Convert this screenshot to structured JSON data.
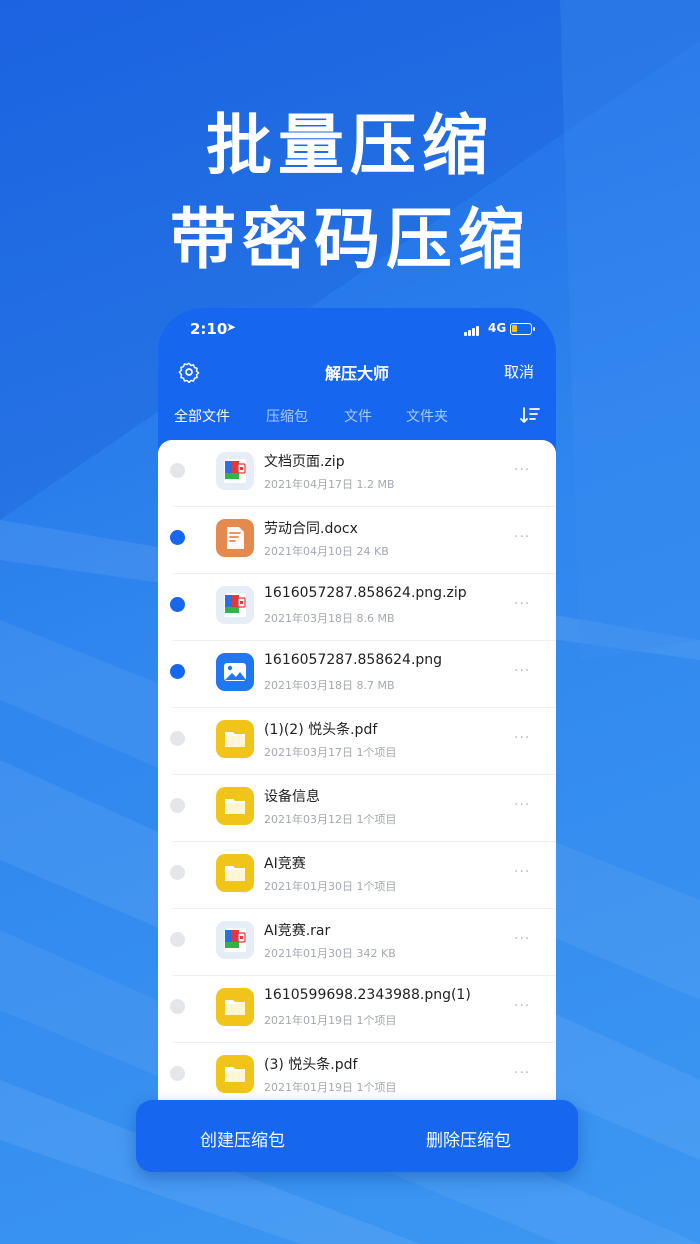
{
  "headline": {
    "line1": "批量压缩",
    "line2": "带密码压缩"
  },
  "status_bar": {
    "time": "2:10",
    "network": "4G"
  },
  "navbar": {
    "title": "解压大师",
    "cancel": "取消"
  },
  "tabs": [
    "全部文件",
    "压缩包",
    "文件",
    "文件夹"
  ],
  "active_tab": "全部文件",
  "files": [
    {
      "name": "文档页面.zip",
      "meta": "2021年04月17日  1.2 MB",
      "icon": "zip-archive-icon",
      "selected": false
    },
    {
      "name": "劳动合同.docx",
      "meta": "2021年04月10日  24 KB",
      "icon": "document-icon",
      "selected": true
    },
    {
      "name": "1616057287.858624.png.zip",
      "meta": "2021年03月18日  8.6 MB",
      "icon": "zip-archive-icon",
      "selected": true
    },
    {
      "name": "1616057287.858624.png",
      "meta": "2021年03月18日  8.7 MB",
      "icon": "image-icon",
      "selected": true
    },
    {
      "name": "(1)(2) 悦头条.pdf",
      "meta": "2021年03月17日  1个项目",
      "icon": "folder-icon",
      "selected": false
    },
    {
      "name": "设备信息",
      "meta": "2021年03月12日  1个项目",
      "icon": "folder-icon",
      "selected": false
    },
    {
      "name": "AI竞赛",
      "meta": "2021年01月30日  1个项目",
      "icon": "folder-icon",
      "selected": false
    },
    {
      "name": "AI竞赛.rar",
      "meta": "2021年01月30日  342 KB",
      "icon": "zip-archive-icon",
      "selected": false
    },
    {
      "name": "1610599698.2343988.png(1)",
      "meta": "2021年01月19日  1个项目",
      "icon": "folder-icon",
      "selected": false
    },
    {
      "name": "(3) 悦头条.pdf",
      "meta": "2021年01月19日  1个项目",
      "icon": "folder-icon",
      "selected": false
    }
  ],
  "more_glyph": "···",
  "bottom_bar": {
    "create": "创建压缩包",
    "delete": "删除压缩包"
  },
  "colors": {
    "brand": "#1766f0",
    "folder": "#f0c419",
    "document": "#e48a4e",
    "selected": "#1766f0"
  }
}
